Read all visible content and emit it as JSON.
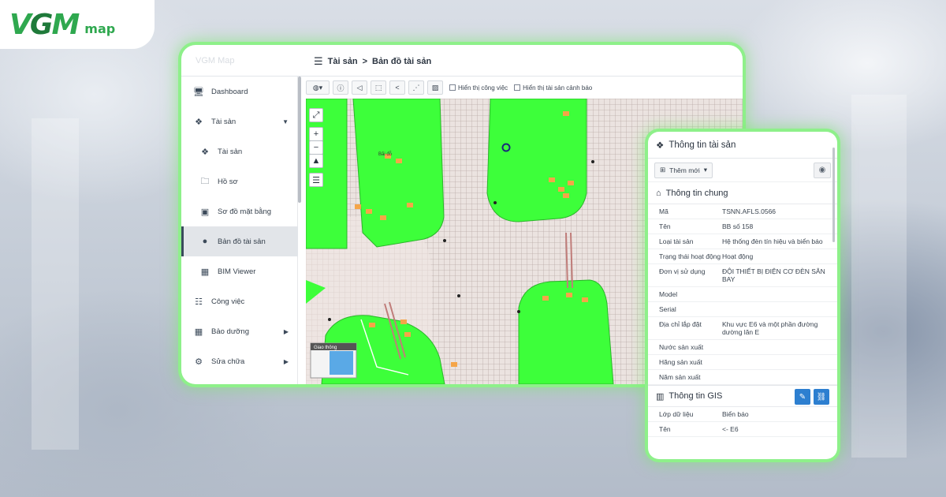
{
  "brand": {
    "mark_v": "V",
    "mark_g": "G",
    "mark_m": "M",
    "sub": "map",
    "faded_title": "VGM Map"
  },
  "header": {
    "title_root": "Tài sản",
    "separator": ">",
    "title_page": "Bản đồ tài sản"
  },
  "sidebar": {
    "items": [
      {
        "label": "Dashboard",
        "icon": "monitor-icon"
      },
      {
        "label": "Tài sản",
        "icon": "cubes-icon"
      },
      {
        "label": "Tài sản",
        "icon": "cubes-icon"
      },
      {
        "label": "Hồ sơ",
        "icon": "folder-icon"
      },
      {
        "label": "Sơ đồ mặt bằng",
        "icon": "floorplan-icon"
      },
      {
        "label": "Bản đồ tài sản",
        "icon": "globe-icon"
      },
      {
        "label": "BIM Viewer",
        "icon": "building-icon"
      },
      {
        "label": "Công việc",
        "icon": "tasks-icon"
      },
      {
        "label": "Bảo dưỡng",
        "icon": "calendar-icon"
      },
      {
        "label": "Sửa chữa",
        "icon": "wrench-icon"
      }
    ]
  },
  "toolbar": {
    "show_tasks": "Hiển thị công việc",
    "show_alerts": "Hiển thị tài sản cảnh báo"
  },
  "map": {
    "minimap_label": "Giao thông",
    "building_label": "Bãi đỗ"
  },
  "panel": {
    "title": "Thông tin tài sản",
    "add_label": "Thêm mới",
    "general_title": "Thông tin chung",
    "general_rows": [
      {
        "k": "Mã",
        "v": "TSNN.AFLS.0566"
      },
      {
        "k": "Tên",
        "v": "BB số 158"
      },
      {
        "k": "Loại tài sản",
        "v": "Hệ thống đèn tín hiệu và biển báo"
      },
      {
        "k": "Trạng thái hoạt động",
        "v": "Hoạt động"
      },
      {
        "k": "Đơn vị sử dụng",
        "v": "ĐỘI THIẾT BỊ ĐIỆN CƠ ĐÈN SÂN BAY"
      },
      {
        "k": "Model",
        "v": ""
      },
      {
        "k": "Serial",
        "v": ""
      },
      {
        "k": "Địa chỉ lắp đặt",
        "v": "Khu vực E6 và một phần đường dường lăn E"
      },
      {
        "k": "Nước sản xuất",
        "v": ""
      },
      {
        "k": "Hãng sản xuất",
        "v": ""
      },
      {
        "k": "Năm sản xuất",
        "v": ""
      }
    ],
    "gis_title": "Thông tin GIS",
    "gis_rows": [
      {
        "k": "Lớp dữ liệu",
        "v": "Biển báo"
      },
      {
        "k": "Tên",
        "v": "<- E6"
      }
    ]
  },
  "colors": {
    "accent_green": "#8ef08a",
    "map_green": "#3dff3a",
    "button_blue": "#2d7fd0"
  }
}
